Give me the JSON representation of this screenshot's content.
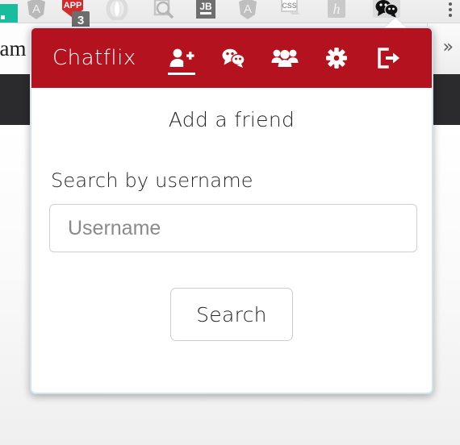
{
  "browser_toolbar": {
    "icons": [
      {
        "name": "teal-extension-icon",
        "label": ""
      },
      {
        "name": "angular-shield-icon",
        "label": "A"
      },
      {
        "name": "appr-extension-icon",
        "label": "APP",
        "badge": "3"
      },
      {
        "name": "opera-ring-icon",
        "label": ""
      },
      {
        "name": "magnifier-page-icon",
        "label": ""
      },
      {
        "name": "jetbrains-jb-icon",
        "label": "JB"
      },
      {
        "name": "angular-shield-icon-2",
        "label": "A"
      },
      {
        "name": "css-stamp-icon",
        "label": "CSS"
      },
      {
        "name": "hyperscript-h-icon",
        "label": "h"
      },
      {
        "name": "chatflix-bubbles-icon",
        "label": ""
      }
    ],
    "overflow_menu": "kebab-menu-icon"
  },
  "background_page": {
    "cut_text": "nam",
    "expand_chevrons": "»"
  },
  "popup": {
    "brand": "Chatflix",
    "nav": [
      {
        "icon": "add-friend-icon",
        "label": "Add a friend",
        "active": true
      },
      {
        "icon": "chat-bubbles-icon",
        "label": "Chats",
        "active": false
      },
      {
        "icon": "group-people-icon",
        "label": "Groups",
        "active": false
      },
      {
        "icon": "gear-settings-icon",
        "label": "Settings",
        "active": false
      },
      {
        "icon": "sign-out-icon",
        "label": "Sign out",
        "active": false
      }
    ],
    "title": "Add a friend",
    "form": {
      "label": "Search by username",
      "input_placeholder": "Username",
      "input_value": "",
      "submit_label": "Search"
    }
  },
  "colors": {
    "brand_red": "#b5121f",
    "popup_border": "#cfe4ee",
    "dark_band": "#2b2b2d",
    "teal_icon": "#19bc9c"
  }
}
